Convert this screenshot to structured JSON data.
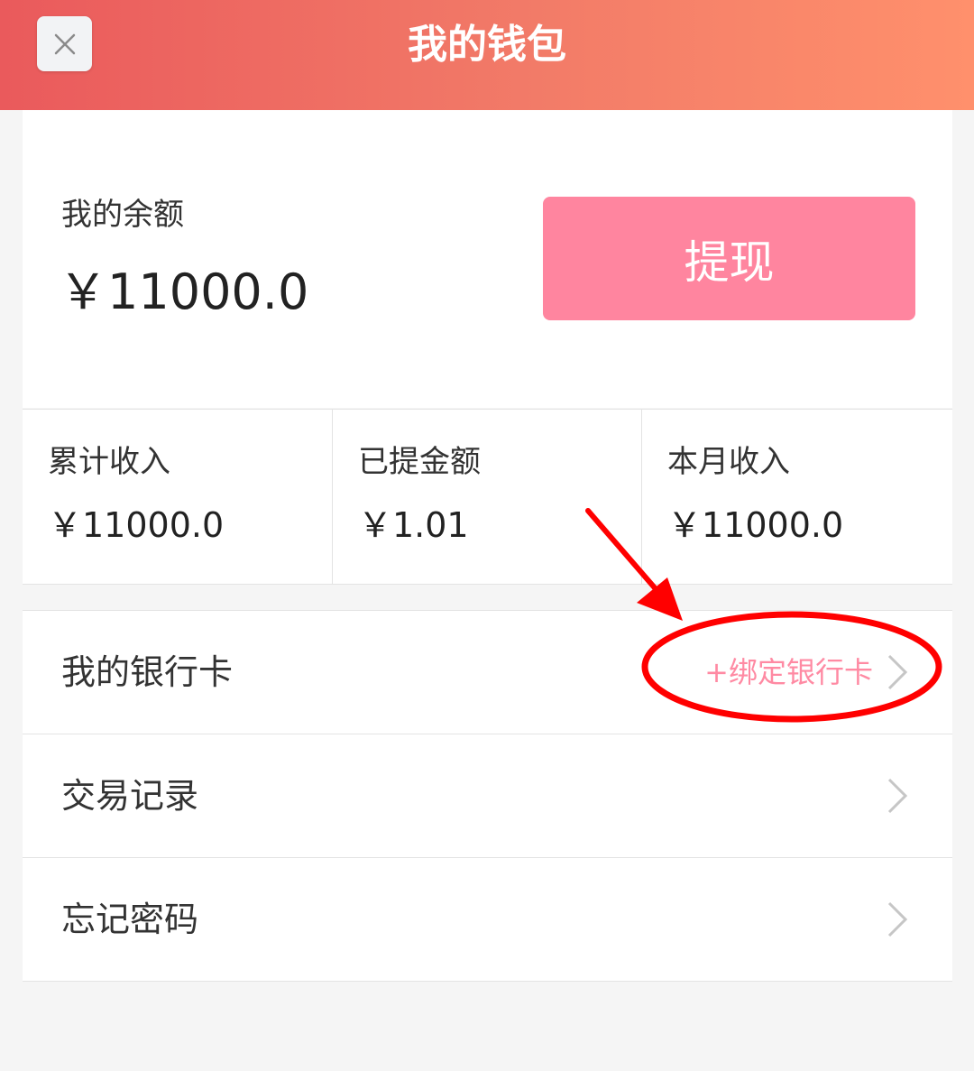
{
  "header": {
    "title": "我的钱包",
    "close_icon": "close-icon"
  },
  "balance": {
    "label": "我的余额",
    "value": "￥11000.0",
    "withdraw_label": "提现"
  },
  "stats": [
    {
      "label": "累计收入",
      "value": "￥11000.0"
    },
    {
      "label": "已提金额",
      "value": "￥1.01"
    },
    {
      "label": "本月收入",
      "value": "￥11000.0"
    }
  ],
  "menu": [
    {
      "label": "我的银行卡",
      "hint": "+绑定银行卡",
      "icon": "chevron-right-icon"
    },
    {
      "label": "交易记录",
      "hint": "",
      "icon": "chevron-right-icon"
    },
    {
      "label": "忘记密码",
      "hint": "",
      "icon": "chevron-right-icon"
    }
  ],
  "colors": {
    "header_start": "#ea5a5c",
    "header_end": "#ff906c",
    "accent_pink": "#ff859f",
    "annotation_red": "#ff0000"
  }
}
